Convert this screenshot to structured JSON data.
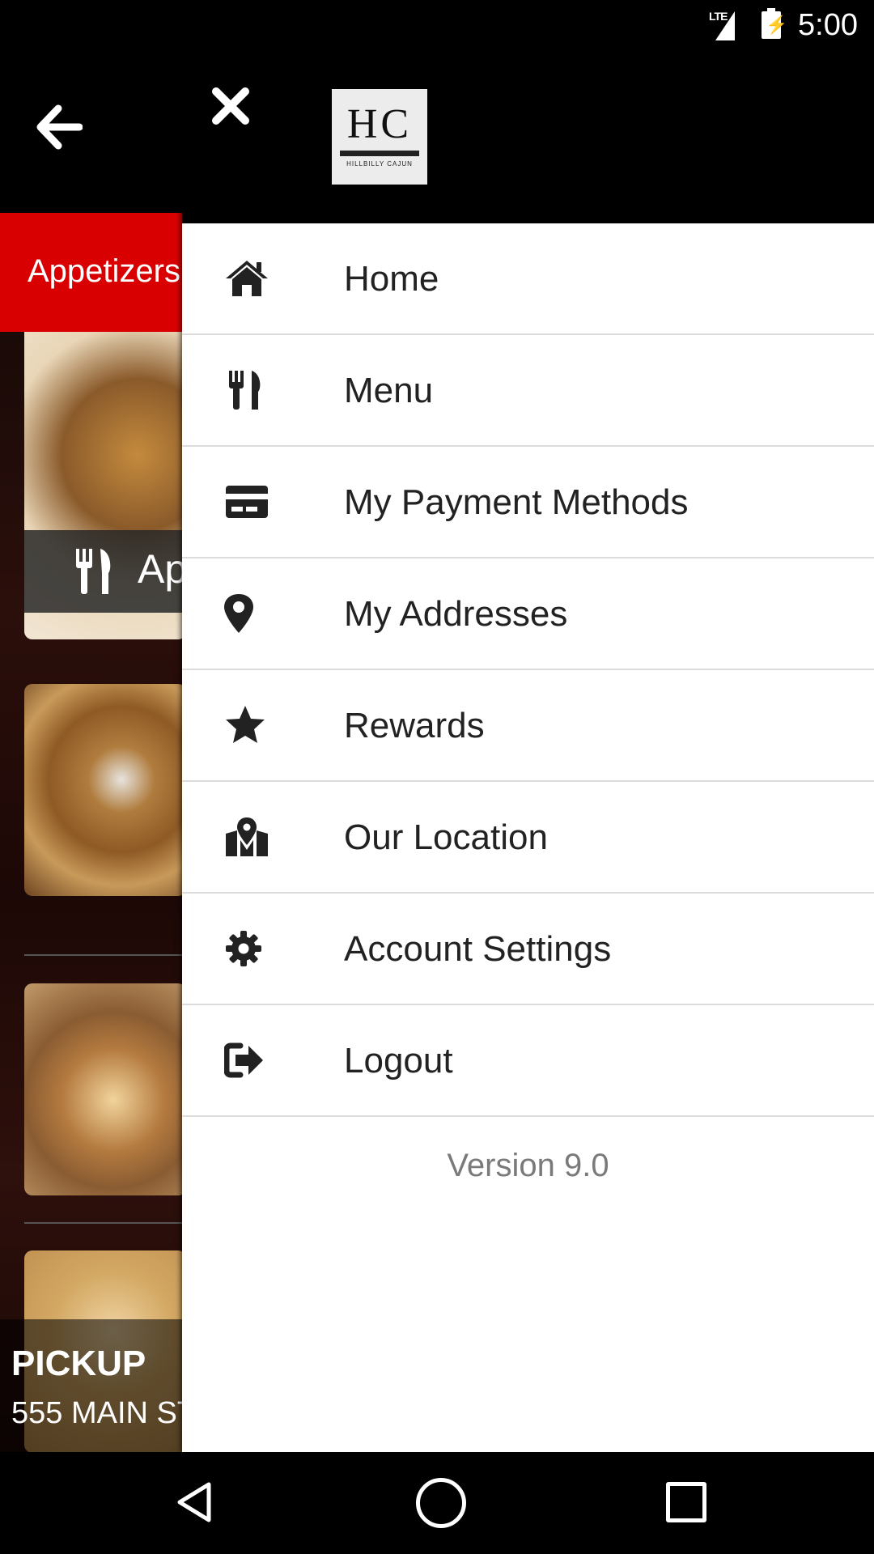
{
  "status_bar": {
    "network": "LTE",
    "time": "5:00"
  },
  "app": {
    "category_tab": "Appetizers",
    "featured_label": "Ap",
    "pickup": {
      "title": "PICKUP",
      "address": "555 MAIN ST"
    }
  },
  "drawer": {
    "logo": {
      "letters": "HC",
      "subtitle": "HILLBILLY CAJUN"
    },
    "items": [
      {
        "label": "Home",
        "icon": "home-icon"
      },
      {
        "label": "Menu",
        "icon": "fork-knife-icon"
      },
      {
        "label": "My Payment Methods",
        "icon": "credit-card-icon"
      },
      {
        "label": "My Addresses",
        "icon": "map-pin-icon"
      },
      {
        "label": "Rewards",
        "icon": "star-icon"
      },
      {
        "label": "Our Location",
        "icon": "map-location-icon"
      },
      {
        "label": "Account Settings",
        "icon": "gear-icon"
      },
      {
        "label": "Logout",
        "icon": "sign-out-icon"
      }
    ],
    "version": "Version 9.0"
  },
  "colors": {
    "accent": "#d80000",
    "drawer_bg": "#ffffff",
    "header_bg": "#000000"
  }
}
